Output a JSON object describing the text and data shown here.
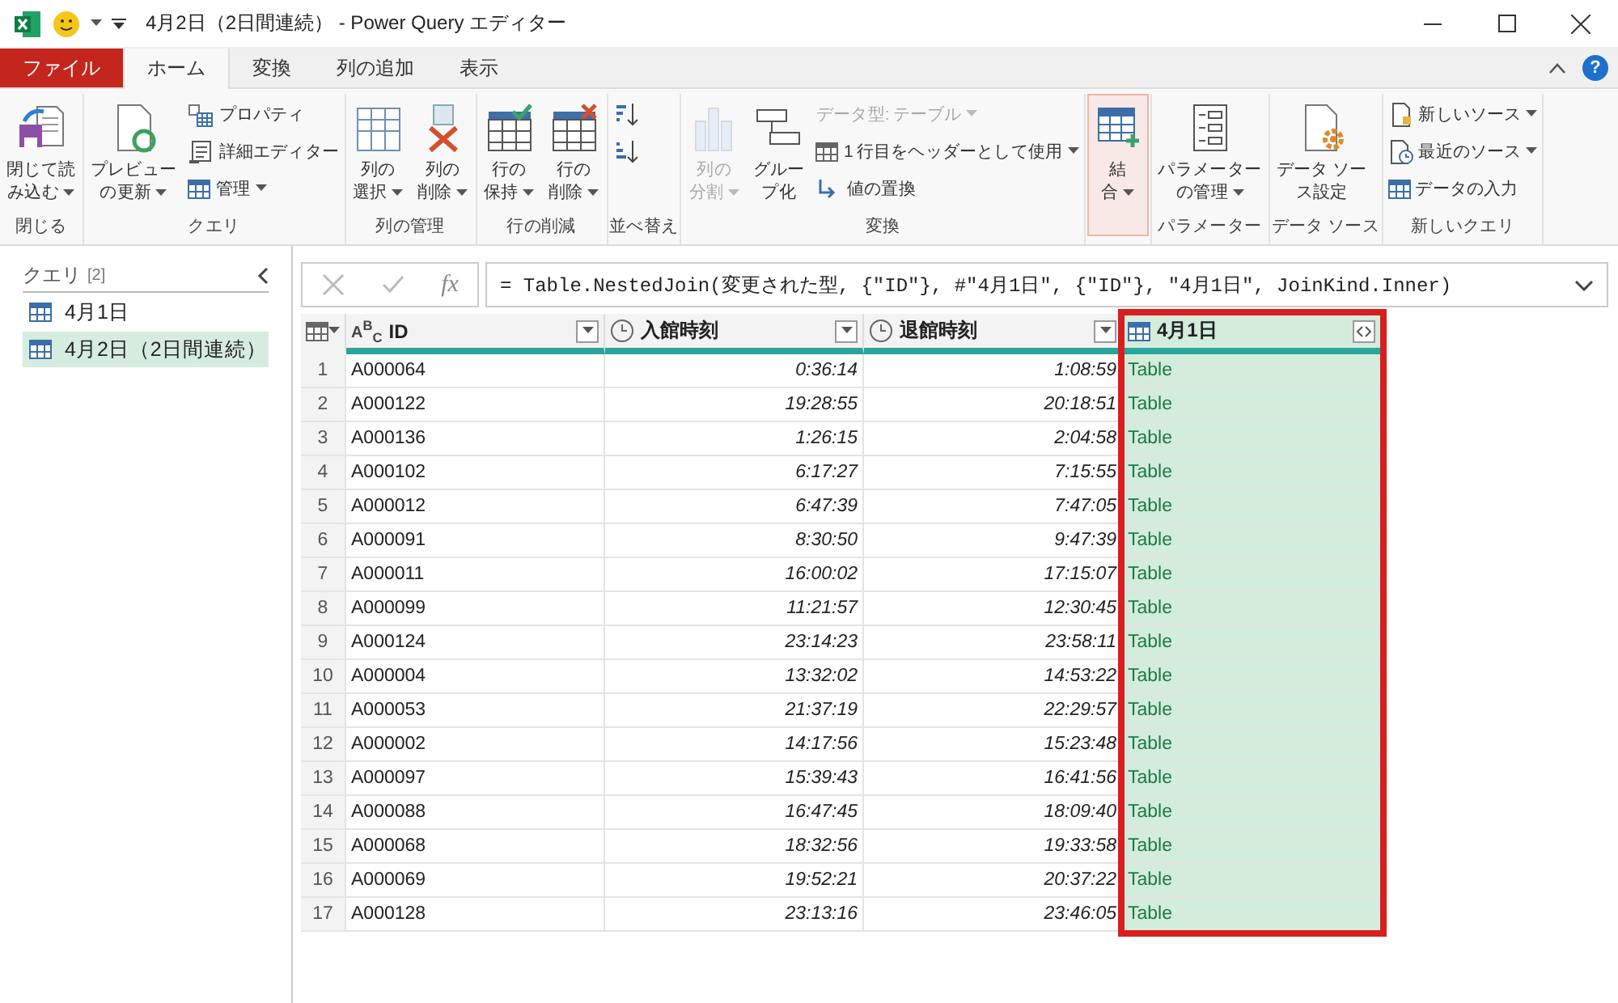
{
  "window": {
    "title": "4月2日（2日間連続） - Power Query エディター"
  },
  "tabs": [
    {
      "label": "ファイル",
      "kind": "file",
      "selected": false
    },
    {
      "label": "ホーム",
      "kind": "tab",
      "selected": true
    },
    {
      "label": "変換",
      "kind": "tab",
      "selected": false
    },
    {
      "label": "列の追加",
      "kind": "tab",
      "selected": false
    },
    {
      "label": "表示",
      "kind": "tab",
      "selected": false
    }
  ],
  "help": {
    "label": "?"
  },
  "ribbon": [
    {
      "label": "閉じる",
      "items": [
        {
          "kind": "large",
          "lines": [
            "閉じて読",
            "み込む"
          ],
          "dropdown": true,
          "disabled": false,
          "active": false
        }
      ]
    },
    {
      "label": "クエリ",
      "items": [
        {
          "kind": "large",
          "lines": [
            "プレビュー",
            "の更新"
          ],
          "dropdown": true,
          "disabled": false,
          "active": false
        },
        {
          "kind": "small",
          "label": "プロパティ",
          "dropdown": false,
          "disabled": false
        },
        {
          "kind": "small",
          "label": "詳細エディター",
          "dropdown": false,
          "disabled": false
        },
        {
          "kind": "small",
          "label": "管理",
          "dropdown": true,
          "disabled": false
        }
      ]
    },
    {
      "label": "列の管理",
      "items": [
        {
          "kind": "large",
          "lines": [
            "列の",
            "選択"
          ],
          "dropdown": true,
          "disabled": false,
          "active": false
        },
        {
          "kind": "large",
          "lines": [
            "列の",
            "削除"
          ],
          "dropdown": true,
          "disabled": false,
          "active": false
        }
      ]
    },
    {
      "label": "行の削減",
      "items": [
        {
          "kind": "large",
          "lines": [
            "行の",
            "保持"
          ],
          "dropdown": true,
          "disabled": false,
          "active": false
        },
        {
          "kind": "large",
          "lines": [
            "行の",
            "削除"
          ],
          "dropdown": true,
          "disabled": false,
          "active": false
        }
      ]
    },
    {
      "label": "並べ替え",
      "items": [
        {
          "kind": "icon",
          "disabled": false
        },
        {
          "kind": "icon",
          "disabled": false
        }
      ]
    },
    {
      "label": "変換",
      "items": [
        {
          "kind": "large",
          "lines": [
            "列の",
            "分割"
          ],
          "dropdown": true,
          "disabled": true,
          "active": false
        },
        {
          "kind": "large",
          "lines": [
            "グルー",
            "プ化"
          ],
          "dropdown": false,
          "disabled": false,
          "active": false
        },
        {
          "kind": "small",
          "label": "データ型: テーブル",
          "dropdown": true,
          "disabled": true
        },
        {
          "kind": "small",
          "label": "1 行目をヘッダーとして使用",
          "dropdown": true,
          "disabled": false
        },
        {
          "kind": "small",
          "label": "値の置換",
          "dropdown": false,
          "disabled": false
        }
      ]
    },
    {
      "items": [
        {
          "kind": "large",
          "lines": [
            "結",
            "合"
          ],
          "dropdown": true,
          "disabled": false,
          "active": true
        }
      ]
    },
    {
      "label": "パラメーター",
      "items": [
        {
          "kind": "large",
          "lines": [
            "パラメーター",
            "の管理"
          ],
          "dropdown": true,
          "disabled": false,
          "active": false
        }
      ]
    },
    {
      "label": "データ ソース",
      "items": [
        {
          "kind": "large",
          "lines": [
            "データ ソー",
            "ス設定"
          ],
          "dropdown": false,
          "disabled": false,
          "active": false
        }
      ]
    },
    {
      "label": "新しいクエリ",
      "items": [
        {
          "kind": "small",
          "label": "新しいソース",
          "dropdown": true,
          "disabled": false
        },
        {
          "kind": "small",
          "label": "最近のソース",
          "dropdown": true,
          "disabled": false
        },
        {
          "kind": "small",
          "label": "データの入力",
          "dropdown": false,
          "disabled": false
        }
      ]
    }
  ],
  "queries": {
    "title": "クエリ",
    "count": "[2]",
    "items": [
      {
        "label": "4月1日",
        "selected": false
      },
      {
        "label": "4月2日（2日間連続）",
        "selected": true
      }
    ]
  },
  "formula_bar": {
    "fx_label": "fx",
    "formula": "= Table.NestedJoin(変更された型, {\"ID\"}, #\"4月1日\", {\"ID\"}, \"4月1日\", JoinKind.Inner)"
  },
  "table": {
    "columns": [
      {
        "kind": "corner"
      },
      {
        "kind": "text",
        "type_glyph": "A$^{B}$$_{C}$",
        "name": "ID",
        "highlighted": false
      },
      {
        "kind": "time",
        "name": "入館時刻",
        "highlighted": false
      },
      {
        "kind": "time",
        "name": "退館時刻",
        "highlighted": false
      },
      {
        "kind": "table",
        "name": "4月1日",
        "highlighted": true
      }
    ],
    "rows": [
      [
        "1",
        "A000064",
        "0:36:14",
        "1:08:59",
        "Table"
      ],
      [
        "2",
        "A000122",
        "19:28:55",
        "20:18:51",
        "Table"
      ],
      [
        "3",
        "A000136",
        "1:26:15",
        "2:04:58",
        "Table"
      ],
      [
        "4",
        "A000102",
        "6:17:27",
        "7:15:55",
        "Table"
      ],
      [
        "5",
        "A000012",
        "6:47:39",
        "7:47:05",
        "Table"
      ],
      [
        "6",
        "A000091",
        "8:30:50",
        "9:47:39",
        "Table"
      ],
      [
        "7",
        "A000011",
        "16:00:02",
        "17:15:07",
        "Table"
      ],
      [
        "8",
        "A000099",
        "11:21:57",
        "12:30:45",
        "Table"
      ],
      [
        "9",
        "A000124",
        "23:14:23",
        "23:58:11",
        "Table"
      ],
      [
        "10",
        "A000004",
        "13:32:02",
        "14:53:22",
        "Table"
      ],
      [
        "11",
        "A000053",
        "21:37:19",
        "22:29:57",
        "Table"
      ],
      [
        "12",
        "A000002",
        "14:17:56",
        "15:23:48",
        "Table"
      ],
      [
        "13",
        "A000097",
        "15:39:43",
        "16:41:56",
        "Table"
      ],
      [
        "14",
        "A000088",
        "16:47:45",
        "18:09:40",
        "Table"
      ],
      [
        "15",
        "A000068",
        "18:32:56",
        "19:33:58",
        "Table"
      ],
      [
        "16",
        "A000069",
        "19:52:21",
        "20:37:22",
        "Table"
      ],
      [
        "17",
        "A000128",
        "23:13:16",
        "23:46:05",
        "Table"
      ]
    ]
  }
}
